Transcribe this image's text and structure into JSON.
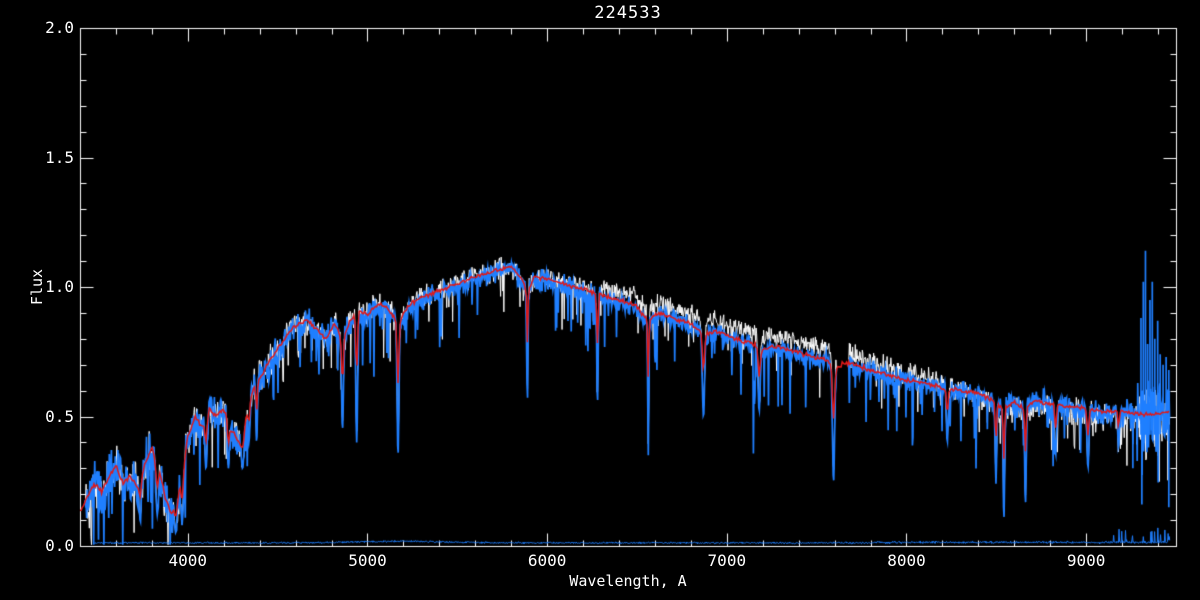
{
  "window": {
    "title": "224533"
  },
  "chart_data": {
    "type": "line",
    "title": "224533",
    "xlabel": "Wavelength, A",
    "ylabel": "Flux",
    "xlim": [
      3400,
      9500
    ],
    "ylim": [
      0.0,
      2.0
    ],
    "x_major_ticks": [
      4000,
      5000,
      6000,
      7000,
      8000,
      9000
    ],
    "x_tick_labels": [
      "4000",
      "5000",
      "6000",
      "7000",
      "8000",
      "9000"
    ],
    "x_minor_step": 200,
    "y_major_ticks": [
      0.0,
      0.5,
      1.0,
      1.5,
      2.0
    ],
    "y_tick_labels": [
      "0.0",
      "0.5",
      "1.0",
      "1.5",
      "2.0"
    ],
    "y_minor_step": 0.1,
    "grid": false,
    "background_color": "#000000",
    "axis_color": "#ffffff",
    "series": [
      {
        "name": "observed-spectrum",
        "color": "#ffffff",
        "style": "noisy-thin"
      },
      {
        "name": "smoothed-spectrum",
        "color": "#1f7fff",
        "style": "noisy-thick"
      },
      {
        "name": "template-fit",
        "color": "#e01919",
        "style": "smooth"
      },
      {
        "name": "error-spectrum",
        "color": "#1f7fff",
        "style": "flat-near-zero"
      }
    ],
    "data_range": [
      3428,
      9465
    ],
    "gap": [
      7612,
      7678
    ],
    "template_points": [
      [
        3400,
        0.13
      ],
      [
        3440,
        0.19
      ],
      [
        3480,
        0.24
      ],
      [
        3520,
        0.21
      ],
      [
        3560,
        0.26
      ],
      [
        3600,
        0.31
      ],
      [
        3640,
        0.24
      ],
      [
        3680,
        0.27
      ],
      [
        3720,
        0.23
      ],
      [
        3760,
        0.31
      ],
      [
        3800,
        0.38
      ],
      [
        3840,
        0.3
      ],
      [
        3880,
        0.17
      ],
      [
        3910,
        0.12
      ],
      [
        3940,
        0.18
      ],
      [
        3970,
        0.27
      ],
      [
        4000,
        0.42
      ],
      [
        4040,
        0.5
      ],
      [
        4080,
        0.46
      ],
      [
        4120,
        0.53
      ],
      [
        4160,
        0.5
      ],
      [
        4200,
        0.53
      ],
      [
        4240,
        0.45
      ],
      [
        4290,
        0.4
      ],
      [
        4330,
        0.52
      ],
      [
        4370,
        0.62
      ],
      [
        4420,
        0.67
      ],
      [
        4470,
        0.73
      ],
      [
        4520,
        0.78
      ],
      [
        4570,
        0.83
      ],
      [
        4620,
        0.86
      ],
      [
        4670,
        0.87
      ],
      [
        4720,
        0.83
      ],
      [
        4770,
        0.8
      ],
      [
        4820,
        0.86
      ],
      [
        4861,
        0.79
      ],
      [
        4900,
        0.87
      ],
      [
        4950,
        0.91
      ],
      [
        5000,
        0.89
      ],
      [
        5050,
        0.93
      ],
      [
        5100,
        0.93
      ],
      [
        5170,
        0.86
      ],
      [
        5230,
        0.93
      ],
      [
        5300,
        0.96
      ],
      [
        5380,
        0.98
      ],
      [
        5450,
        1.0
      ],
      [
        5530,
        1.02
      ],
      [
        5600,
        1.04
      ],
      [
        5700,
        1.06
      ],
      [
        5800,
        1.08
      ],
      [
        5850,
        1.04
      ],
      [
        5890,
        0.98
      ],
      [
        5930,
        1.04
      ],
      [
        6000,
        1.03
      ],
      [
        6100,
        1.01
      ],
      [
        6200,
        0.99
      ],
      [
        6300,
        0.97
      ],
      [
        6400,
        0.95
      ],
      [
        6490,
        0.93
      ],
      [
        6560,
        0.87
      ],
      [
        6620,
        0.9
      ],
      [
        6700,
        0.88
      ],
      [
        6800,
        0.86
      ],
      [
        6870,
        0.82
      ],
      [
        6950,
        0.83
      ],
      [
        7050,
        0.8
      ],
      [
        7150,
        0.78
      ],
      [
        7200,
        0.76
      ],
      [
        7280,
        0.77
      ],
      [
        7380,
        0.75
      ],
      [
        7480,
        0.73
      ],
      [
        7560,
        0.72
      ],
      [
        7605,
        0.68
      ],
      [
        7650,
        0.71
      ],
      [
        7720,
        0.7
      ],
      [
        7800,
        0.68
      ],
      [
        7900,
        0.66
      ],
      [
        8000,
        0.64
      ],
      [
        8100,
        0.63
      ],
      [
        8200,
        0.61
      ],
      [
        8300,
        0.6
      ],
      [
        8400,
        0.59
      ],
      [
        8480,
        0.56
      ],
      [
        8540,
        0.53
      ],
      [
        8600,
        0.56
      ],
      [
        8660,
        0.53
      ],
      [
        8720,
        0.56
      ],
      [
        8800,
        0.55
      ],
      [
        8900,
        0.54
      ],
      [
        9000,
        0.53
      ],
      [
        9100,
        0.52
      ],
      [
        9200,
        0.52
      ],
      [
        9300,
        0.51
      ],
      [
        9400,
        0.51
      ],
      [
        9465,
        0.52
      ]
    ],
    "absorption_lines": [
      [
        3735,
        6,
        0.1
      ],
      [
        3830,
        7,
        0.12
      ],
      [
        3933,
        7,
        0.05
      ],
      [
        3968,
        6,
        0.08
      ],
      [
        4101,
        6,
        0.3
      ],
      [
        4226,
        5,
        0.3
      ],
      [
        4305,
        8,
        0.3
      ],
      [
        4340,
        5,
        0.4
      ],
      [
        4383,
        4,
        0.4
      ],
      [
        4861,
        5,
        0.45
      ],
      [
        4940,
        5,
        0.4
      ],
      [
        5170,
        5,
        0.35
      ],
      [
        5890,
        3,
        0.55
      ],
      [
        6280,
        4,
        0.55
      ],
      [
        6563,
        3,
        0.35
      ],
      [
        6870,
        6,
        0.5
      ],
      [
        7180,
        6,
        0.52
      ],
      [
        7594,
        6,
        0.25
      ],
      [
        8227,
        5,
        0.4
      ],
      [
        8498,
        4,
        0.24
      ],
      [
        8542,
        4,
        0.1
      ],
      [
        8662,
        4,
        0.16
      ],
      [
        8830,
        5,
        0.35
      ],
      [
        9010,
        5,
        0.3
      ],
      [
        9180,
        4,
        0.38
      ]
    ],
    "noise_regions": [
      [
        3400,
        4000,
        0.075
      ],
      [
        4000,
        4500,
        0.055
      ],
      [
        4500,
        5200,
        0.045
      ],
      [
        5200,
        6300,
        0.035
      ],
      [
        6300,
        7600,
        0.03
      ],
      [
        7600,
        8500,
        0.035
      ],
      [
        8500,
        9280,
        0.045
      ],
      [
        9280,
        9500,
        0.12
      ]
    ],
    "white_offset_points": [
      [
        3400,
        0
      ],
      [
        6100,
        0
      ],
      [
        6500,
        0.04
      ],
      [
        7600,
        0.045
      ],
      [
        7700,
        0.035
      ],
      [
        8100,
        0.025
      ],
      [
        8400,
        -0.01
      ],
      [
        8800,
        -0.02
      ],
      [
        9500,
        -0.02
      ]
    ],
    "up_spikes": [
      [
        9305,
        0.88
      ],
      [
        9318,
        1.02
      ],
      [
        9330,
        1.14
      ],
      [
        9342,
        0.78
      ],
      [
        9355,
        0.95
      ],
      [
        9368,
        1.02
      ],
      [
        9382,
        0.8
      ],
      [
        9398,
        0.87
      ],
      [
        9412,
        0.74
      ],
      [
        9428,
        0.7
      ],
      [
        9445,
        0.73
      ],
      [
        9460,
        0.68
      ]
    ],
    "down_spikes": [
      [
        9260,
        0.3
      ],
      [
        9310,
        0.16
      ],
      [
        9460,
        0.15
      ]
    ],
    "sigma_trace": {
      "base": 0.012,
      "noise": 0.003,
      "bump_center": 5200,
      "bump_height": 0.006,
      "rough_start": 7800,
      "spike_region_start": 9150,
      "spike_max": 0.055
    }
  }
}
